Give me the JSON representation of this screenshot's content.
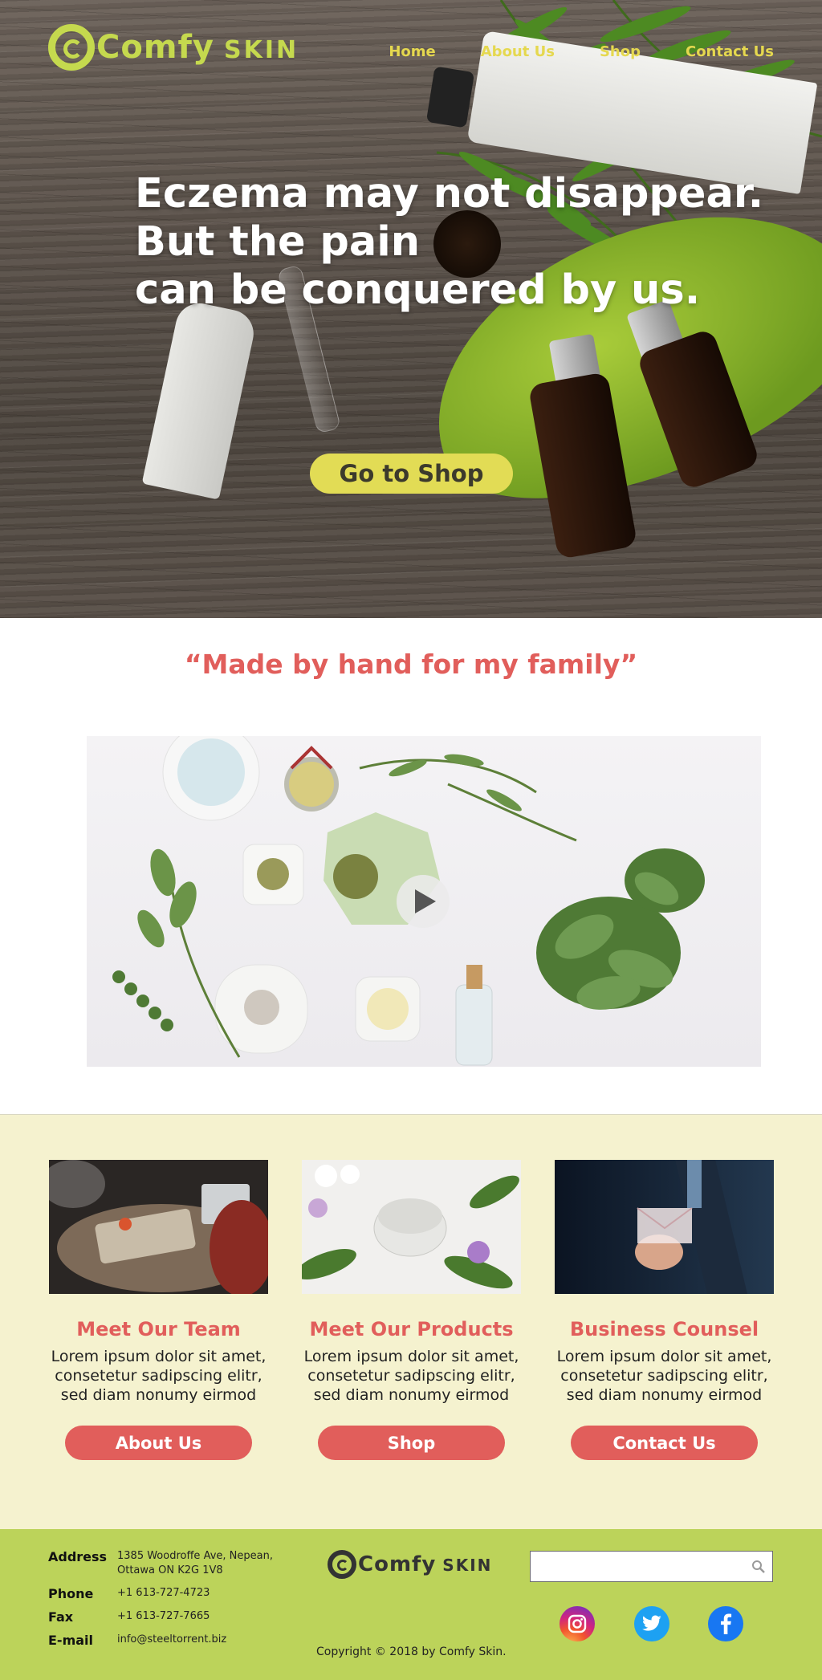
{
  "brand": {
    "name_main": "Comfy",
    "name_small": "SKIN"
  },
  "nav": [
    {
      "label": "Home"
    },
    {
      "label": "About Us"
    },
    {
      "label": "Shop"
    },
    {
      "label": "Contact Us"
    }
  ],
  "hero": {
    "headline_lines": [
      "Eczema may not disappear.",
      "But the pain",
      "can be conquered by us."
    ],
    "cta_label": "Go to Shop"
  },
  "quote": "“Made by hand for my family”",
  "video": {
    "play_icon": "play-icon"
  },
  "features": [
    {
      "title": "Meet Our Team",
      "text_lines": [
        "Lorem ipsum dolor sit amet,",
        "consetetur sadipscing elitr,",
        "sed diam nonumy eirmod"
      ],
      "button": "About Us"
    },
    {
      "title": "Meet Our Products",
      "text_lines": [
        "Lorem ipsum dolor sit amet,",
        "consetetur sadipscing elitr,",
        "sed diam nonumy eirmod"
      ],
      "button": "Shop"
    },
    {
      "title": "Business Counsel",
      "text_lines": [
        "Lorem ipsum dolor sit amet,",
        "consetetur sadipscing elitr,",
        "sed diam nonumy eirmod"
      ],
      "button": "Contact Us"
    }
  ],
  "footer": {
    "contact": [
      {
        "key": "Address",
        "value_lines": [
          "1385 Woodroffe Ave, Nepean,",
          "Ottawa ON K2G 1V8"
        ]
      },
      {
        "key": "Phone",
        "value_lines": [
          "+1 613-727-4723"
        ]
      },
      {
        "key": "Fax",
        "value_lines": [
          "+1 613-727-7665"
        ]
      },
      {
        "key": "E-mail",
        "value_lines": [
          "info@steeltorrent.biz"
        ]
      }
    ],
    "logo_main": "Comfy",
    "logo_small": "SKIN",
    "copyright": "Copyright © 2018 by Comfy Skin.",
    "search_placeholder": "",
    "social": [
      "instagram-icon",
      "twitter-icon",
      "facebook-icon"
    ]
  },
  "colors": {
    "accent_green": "#c5d94e",
    "nav_yellow": "#e5d84f",
    "cta_yellow": "#e2dc55",
    "coral": "#e15e5b",
    "cream": "#f5f2cf",
    "footer_green": "#bcd35a"
  }
}
